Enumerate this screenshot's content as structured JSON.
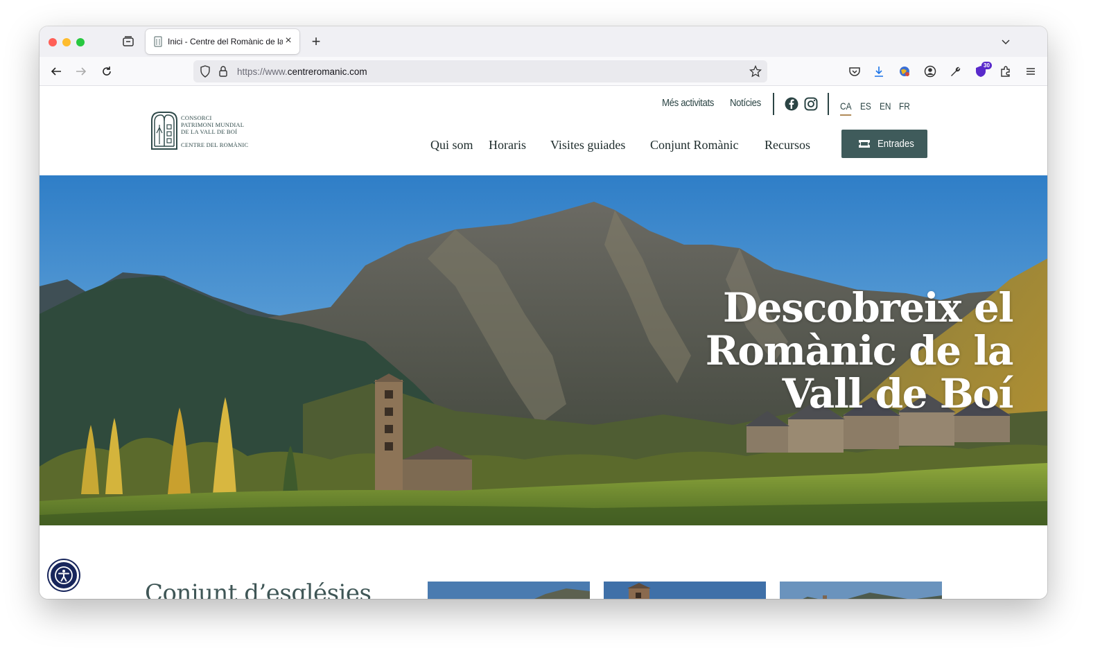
{
  "browser": {
    "tab_title": "Inici - Centre del Romànic de la Vall de Boí",
    "url_scheme": "https://www.",
    "url_host": "centreromanic.com",
    "extension_badge": "30"
  },
  "site": {
    "logo": {
      "line1": "CONSORCI",
      "line2": "PATRIMONI MUNDIAL",
      "line3": "DE LA VALL DE BOÍ",
      "line4": "CENTRE DEL ROMÀNIC"
    },
    "top_nav": {
      "more_activities": "Més activitats",
      "news": "Notícies"
    },
    "languages": [
      "CA",
      "ES",
      "EN",
      "FR"
    ],
    "active_language": "CA",
    "main_nav": [
      "Qui som",
      "Horaris",
      "Visites guiades",
      "Conjunt Romànic",
      "Recursos"
    ],
    "tickets_label": "Entrades",
    "hero": {
      "title": "Descobreix el Romànic de la Vall de Boí"
    },
    "section_title": "Conjunt d’esglésies"
  },
  "colors": {
    "brand_dark": "#2b4444",
    "button": "#3f5b5b",
    "accent_underline": "#b08a58",
    "a11y": "#18265c"
  }
}
